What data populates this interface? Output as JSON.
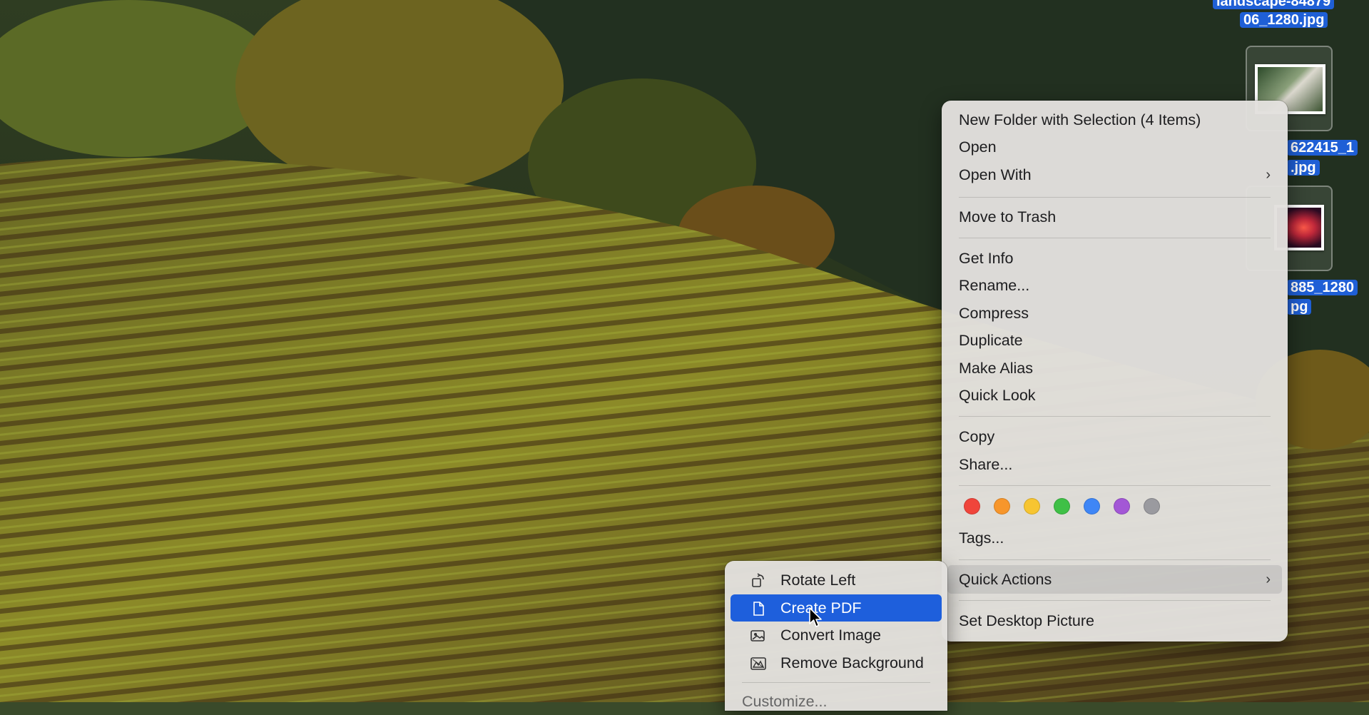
{
  "desktop": {
    "files": [
      {
        "name_line1": "landscape-84879",
        "name_line2": "06_1280.jpg"
      },
      {
        "name_line1": "622415_1",
        "name_line2": ".jpg"
      },
      {
        "name_line1": "885_1280",
        "name_line2": "pg"
      }
    ]
  },
  "context_menu": {
    "items": {
      "new_folder": "New Folder with Selection (4 Items)",
      "open": "Open",
      "open_with": "Open With",
      "move_to_trash": "Move to Trash",
      "get_info": "Get Info",
      "rename": "Rename...",
      "compress": "Compress",
      "duplicate": "Duplicate",
      "make_alias": "Make Alias",
      "quick_look": "Quick Look",
      "copy": "Copy",
      "share": "Share...",
      "tags": "Tags...",
      "quick_actions": "Quick Actions",
      "set_desktop_picture": "Set Desktop Picture"
    },
    "tag_colors": [
      "#f0453b",
      "#f7962b",
      "#f7c531",
      "#3fc046",
      "#3e86f6",
      "#a357d6",
      "#9a9a9f"
    ],
    "submenu_chevron": "›"
  },
  "quick_actions_submenu": {
    "items": [
      {
        "label": "Rotate Left",
        "icon": "rotate-left-icon"
      },
      {
        "label": "Create PDF",
        "icon": "document-icon",
        "highlighted": true
      },
      {
        "label": "Convert Image",
        "icon": "image-icon"
      },
      {
        "label": "Remove Background",
        "icon": "remove-background-icon"
      },
      {
        "label": "Customize...",
        "icon": ""
      }
    ]
  },
  "colors": {
    "selection_blue": "#1e5fdc",
    "menu_background": "#e2e0dd"
  }
}
